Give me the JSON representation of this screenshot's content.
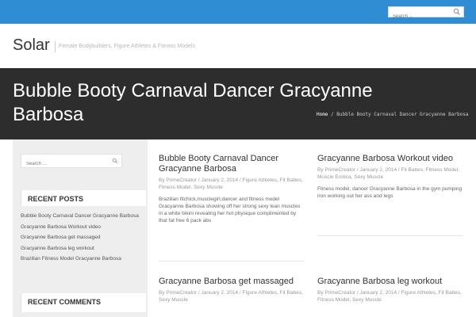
{
  "top_search": {
    "placeholder": "Search ..."
  },
  "header": {
    "logo": "Solar",
    "tagline": "Female Bodybuilders, Figure Athletes & Fitness Models"
  },
  "title_band": {
    "title": "Bubble Booty Carnaval Dancer Gracyanne Barbosa",
    "breadcrumb_home": "Home",
    "breadcrumb_current": "/ Bubble Booty Carnaval Dancer Gracyanne Barbosa"
  },
  "sidebar": {
    "search_placeholder": "Search ...",
    "recent_posts_title": "RECENT POSTS",
    "recent_posts": [
      "Bubble Booty Carnaval Dancer Gracyanne Barbosa",
      "Gracyanne Barbosa Workout video",
      "Gracyanne Barbosa get massaged",
      "Gracyanne Barbosa leg workout",
      "Brazilian Fitness Model Gracyanne Barbosa"
    ],
    "recent_comments_title": "RECENT COMMENTS"
  },
  "posts": [
    {
      "title": "Bubble Booty Carnaval Dancer Gracyanne Barbosa",
      "by": "By",
      "author": "PrimeCreator",
      "date": "January 2, 2014",
      "categories": "Figure Athletes, Fit Babes, Fitness Model, Sexy Muscle",
      "excerpt": "Brazilian fitchick,musclegirl,dancer and fitness model Gracyanne Barbosa showing off her strong sexy lean muscles in a white bikini revealing her hot physique complimented by that fat free 6 pack abs"
    },
    {
      "title": "Gracyanne Barbosa Workout video",
      "by": "By",
      "author": "PrimeCreator",
      "date": "January 2, 2014",
      "categories": "Fit Babes, Fitness Model, Muscle Erotica, Sexy Muscle",
      "excerpt": "Fitness model, dancer Gracyanne Barbosa in the gym pumping iron working out her ass and legs"
    },
    {
      "title": "Gracyanne Barbosa get massaged",
      "by": "By",
      "author": "PrimeCreator",
      "date": "January 2, 2014",
      "categories": "Figure Athletes, Fit Babes, Sexy Muscle",
      "excerpt": ""
    },
    {
      "title": "Gracyanne Barbosa leg workout",
      "by": "By",
      "author": "PrimeCreator",
      "date": "January 2, 2014",
      "categories": "Figure Athletes, Fit Babes, Fitness Model, Sexy Muscle",
      "excerpt": ""
    }
  ],
  "icons": {
    "search": "magnifier-icon"
  },
  "colors": {
    "topbar": "#2f8dd4",
    "title_band": "#2d2d2d",
    "sidebar": "#eeeeee"
  }
}
